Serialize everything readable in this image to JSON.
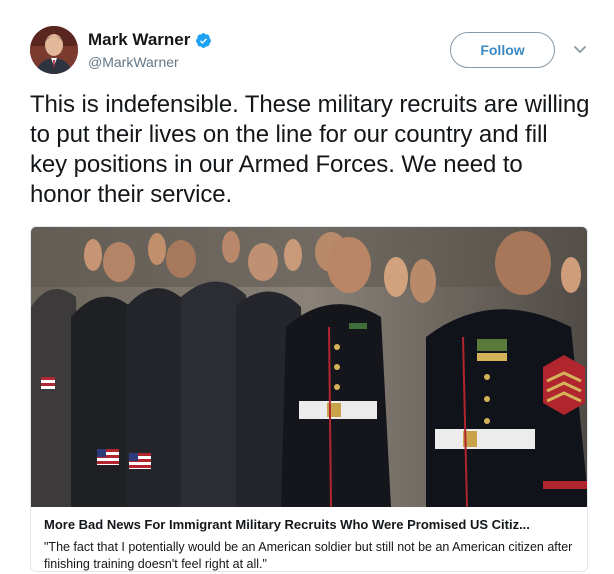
{
  "author": {
    "name": "Mark Warner",
    "handle": "@MarkWarner",
    "verified": true,
    "avatar_icon": "profile-photo"
  },
  "actions": {
    "follow_label": "Follow",
    "menu_icon": "chevron-down-icon"
  },
  "tweet": {
    "text": "This is indefensible. These military recruits are willing to put their lives on the line for our country and fill key positions in our Armed Forces. We need to honor their service."
  },
  "card": {
    "image_alt": "photo",
    "title": "More Bad News For Immigrant Military Recruits Who Were Promised US Citiz...",
    "description": "\"The fact that I potentially would be an American soldier but still not be an American citizen after finishing training doesn't feel right at all.\""
  },
  "colors": {
    "accent": "#1da1f2",
    "verified": "#1da1f2",
    "muted": "#657786",
    "border": "#e1e8ed"
  }
}
